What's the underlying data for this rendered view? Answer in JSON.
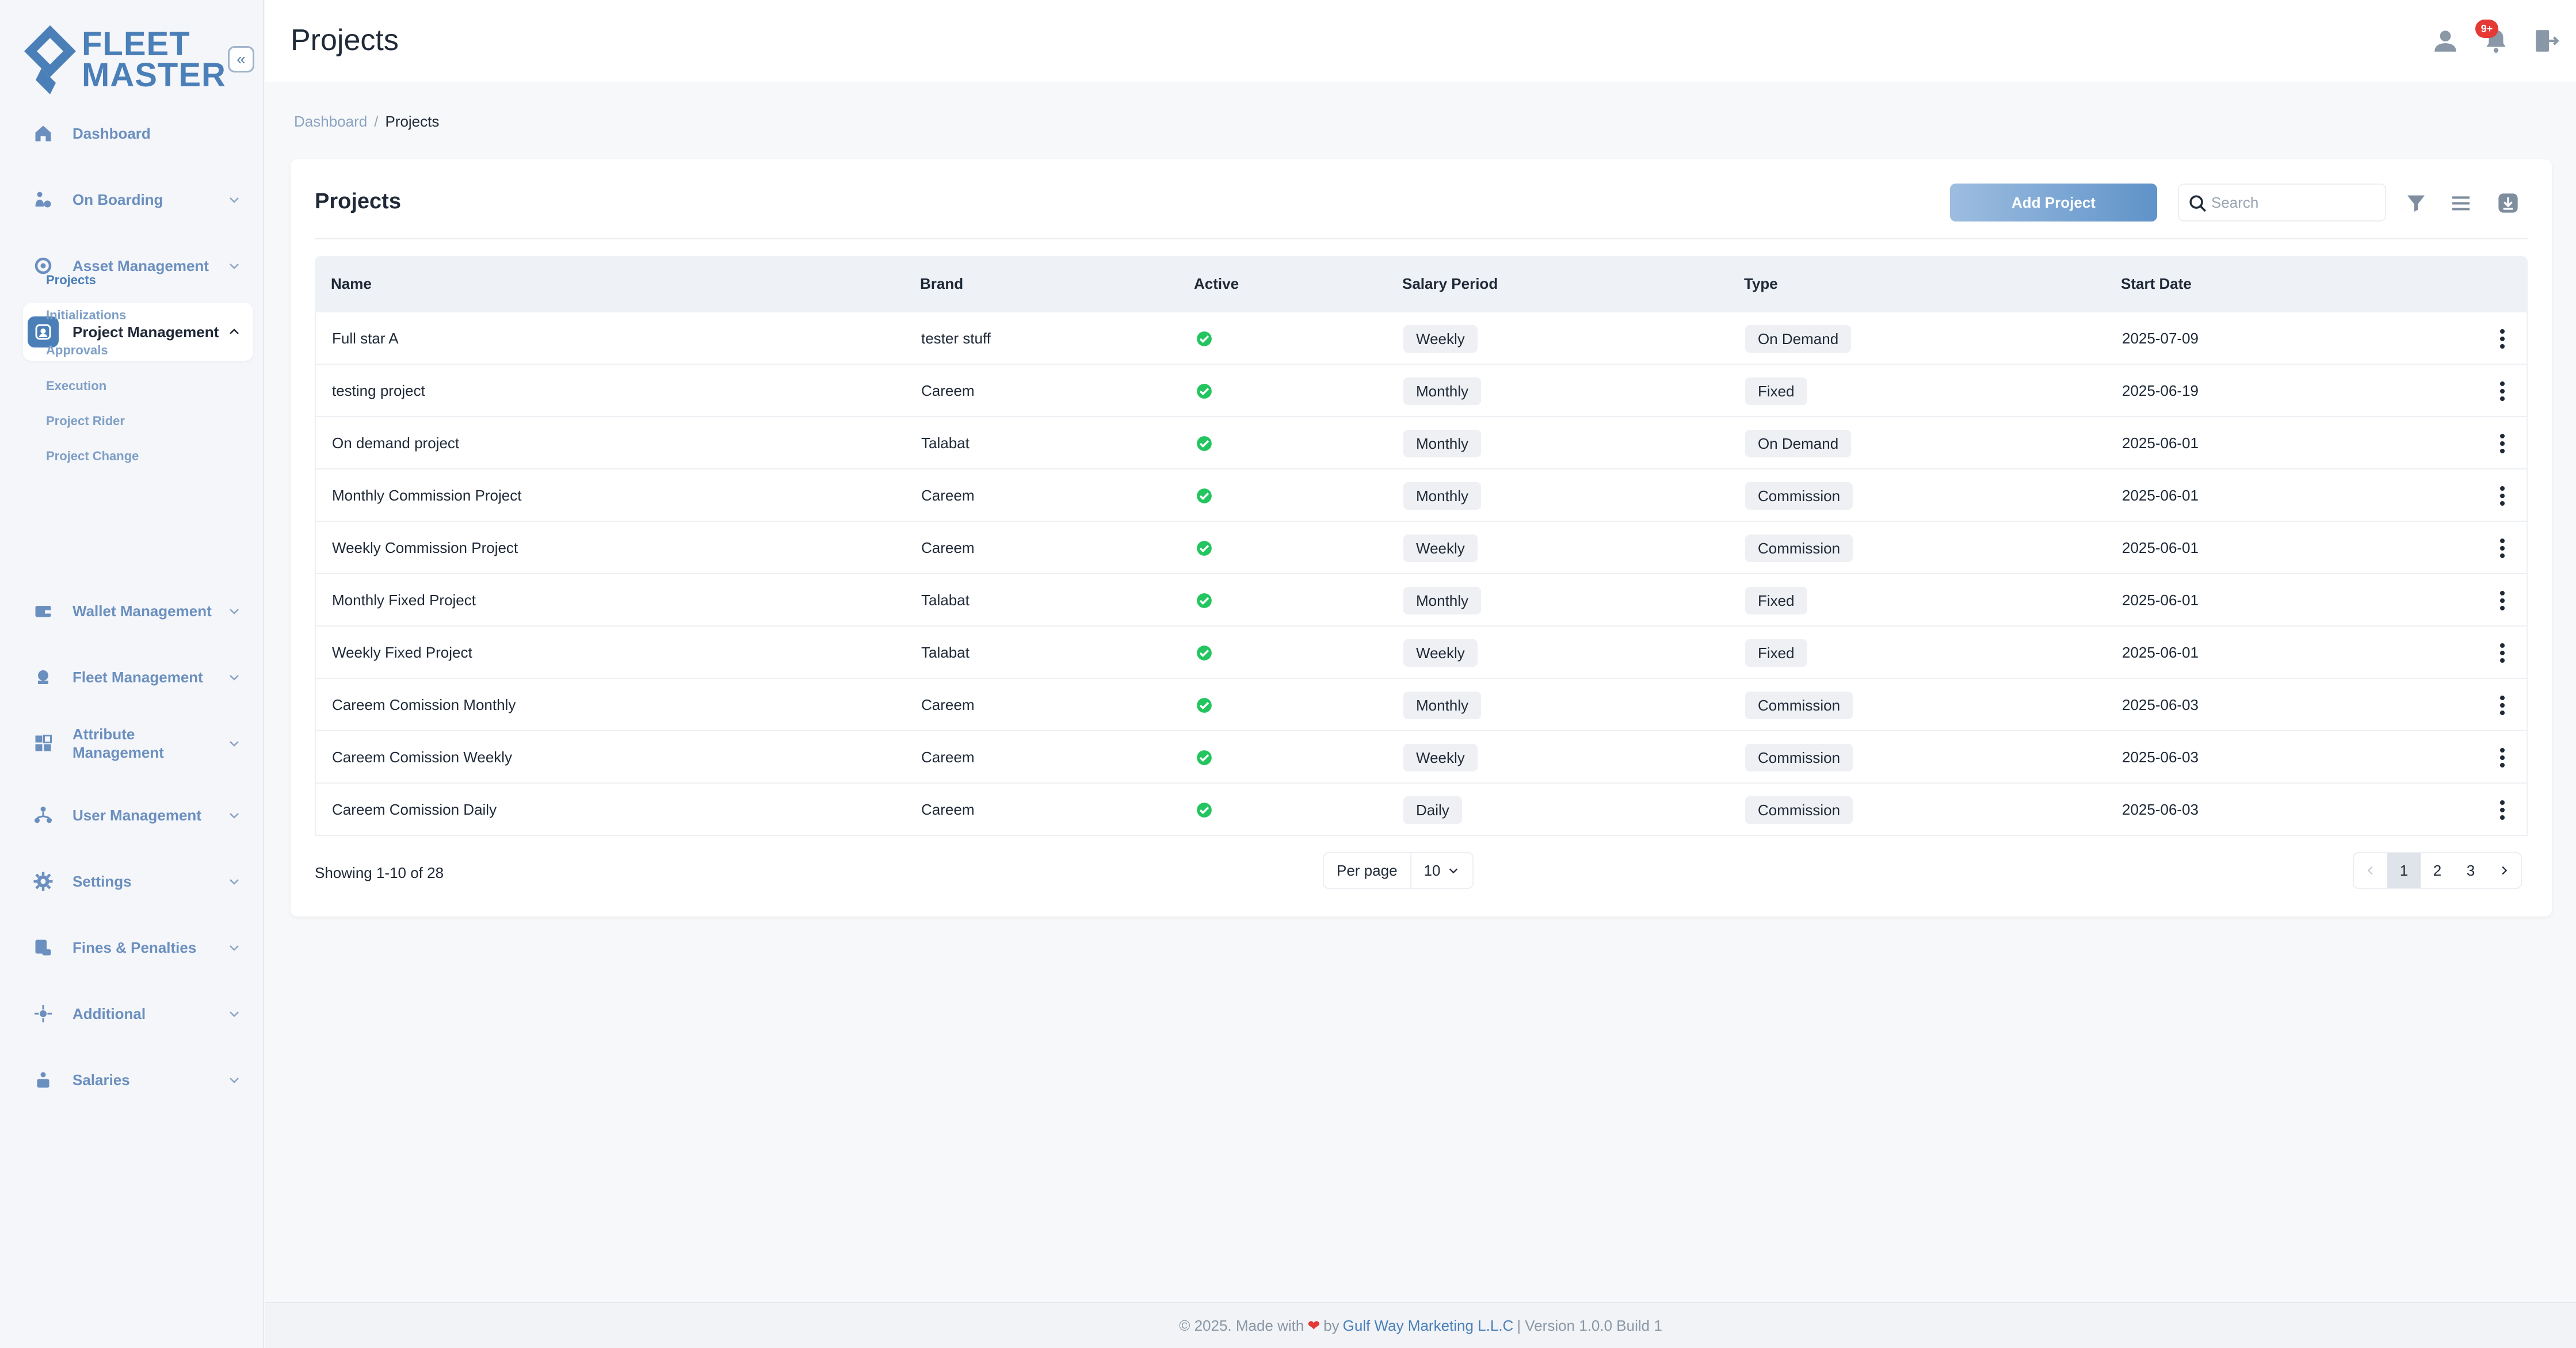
{
  "app": {
    "logo_line1": "FLEET",
    "logo_line2": "MASTER",
    "collapse_icon": "«"
  },
  "colors": {
    "brand": "#4a7fb8",
    "active_check": "#22c55e",
    "badge": "#e53935"
  },
  "sidebar": {
    "items": [
      {
        "label": "Dashboard",
        "icon": "home-icon"
      },
      {
        "label": "On Boarding",
        "icon": "onboarding-icon"
      },
      {
        "label": "Asset Management",
        "icon": "asset-icon"
      },
      {
        "label": "Project Management",
        "icon": "project-icon",
        "active": true
      },
      {
        "label": "Wallet Management",
        "icon": "wallet-icon"
      },
      {
        "label": "Fleet Management",
        "icon": "fleet-icon"
      },
      {
        "label": "Attribute Management",
        "icon": "attribute-icon"
      },
      {
        "label": "User Management",
        "icon": "users-icon"
      },
      {
        "label": "Settings",
        "icon": "gear-icon"
      },
      {
        "label": "Fines & Penalties",
        "icon": "fines-icon"
      },
      {
        "label": "Additional",
        "icon": "additional-icon"
      },
      {
        "label": "Salaries",
        "icon": "salaries-icon"
      }
    ],
    "sub_items": [
      "Projects",
      "Initializations",
      "Approvals",
      "Execution",
      "Project Rider",
      "Project Change"
    ]
  },
  "header": {
    "title": "Projects",
    "notification_badge": "9+"
  },
  "breadcrumb": {
    "root": "Dashboard",
    "separator": "/",
    "current": "Projects"
  },
  "card": {
    "title": "Projects",
    "add_label": "Add Project",
    "search_placeholder": "Search"
  },
  "table": {
    "columns": [
      "Name",
      "Brand",
      "Active",
      "Salary Period",
      "Type",
      "Start Date"
    ],
    "rows": [
      {
        "name": "Full star A",
        "brand": "tester stuff",
        "period": "Weekly",
        "type": "On Demand",
        "start": "2025-07-09"
      },
      {
        "name": "testing project",
        "brand": "Careem",
        "period": "Monthly",
        "type": "Fixed",
        "start": "2025-06-19"
      },
      {
        "name": "On demand project",
        "brand": "Talabat",
        "period": "Monthly",
        "type": "On Demand",
        "start": "2025-06-01"
      },
      {
        "name": "Monthly Commission Project",
        "brand": "Careem",
        "period": "Monthly",
        "type": "Commission",
        "start": "2025-06-01"
      },
      {
        "name": "Weekly Commission Project",
        "brand": "Careem",
        "period": "Weekly",
        "type": "Commission",
        "start": "2025-06-01"
      },
      {
        "name": "Monthly Fixed Project",
        "brand": "Talabat",
        "period": "Monthly",
        "type": "Fixed",
        "start": "2025-06-01"
      },
      {
        "name": "Weekly Fixed Project",
        "brand": "Talabat",
        "period": "Weekly",
        "type": "Fixed",
        "start": "2025-06-01"
      },
      {
        "name": "Careem Comission Monthly",
        "brand": "Careem",
        "period": "Monthly",
        "type": "Commission",
        "start": "2025-06-03"
      },
      {
        "name": "Careem Comission Weekly",
        "brand": "Careem",
        "period": "Weekly",
        "type": "Commission",
        "start": "2025-06-03"
      },
      {
        "name": "Careem Comission Daily",
        "brand": "Careem",
        "period": "Daily",
        "type": "Commission",
        "start": "2025-06-03"
      }
    ]
  },
  "pagination": {
    "showing": "Showing 1-10 of 28",
    "per_page_label": "Per page",
    "per_page_value": "10",
    "pages": [
      "1",
      "2",
      "3"
    ],
    "current": "1"
  },
  "footer": {
    "prefix": "© 2025. Made with",
    "by": "by",
    "company": "Gulf Way Marketing L.L.C",
    "version": "| Version 1.0.0 Build 1"
  }
}
